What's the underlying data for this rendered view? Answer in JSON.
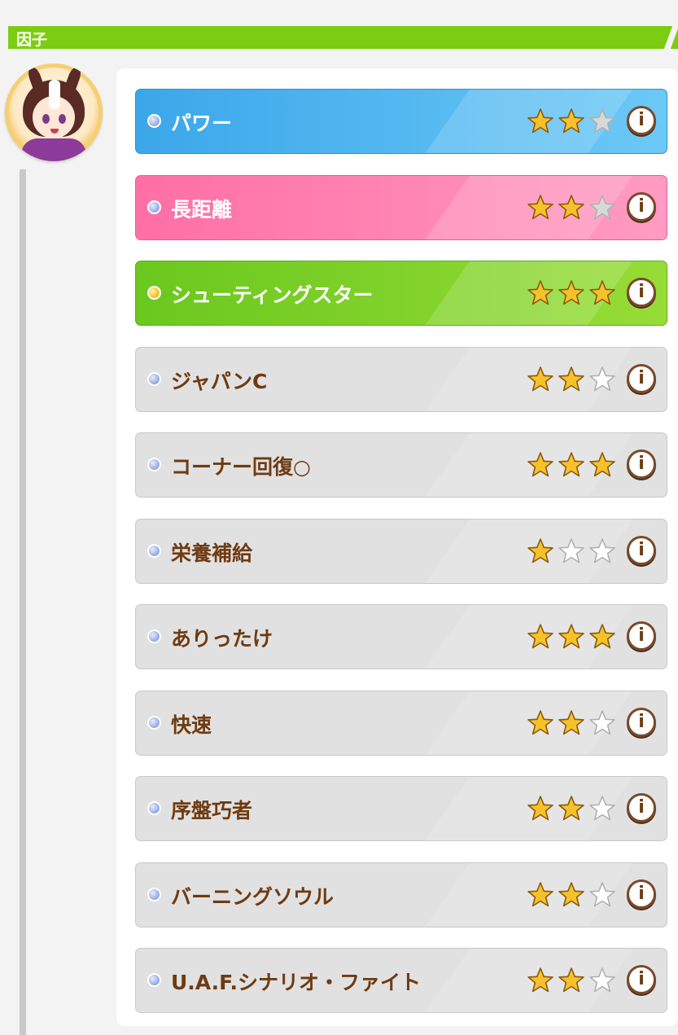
{
  "header": {
    "title": "因子"
  },
  "factors": [
    {
      "name": "パワー",
      "stars": 2,
      "style": "blue",
      "dot": "blue"
    },
    {
      "name": "長距離",
      "stars": 2,
      "style": "pink",
      "dot": "blue"
    },
    {
      "name": "シューティングスター",
      "stars": 3,
      "style": "green",
      "dot": "gold"
    },
    {
      "name": "ジャパンC",
      "stars": 2,
      "style": "grey",
      "dot": "blue"
    },
    {
      "name": "コーナー回復○",
      "stars": 3,
      "style": "grey",
      "dot": "blue"
    },
    {
      "name": "栄養補給",
      "stars": 1,
      "style": "grey",
      "dot": "blue"
    },
    {
      "name": "ありったけ",
      "stars": 3,
      "style": "grey",
      "dot": "blue"
    },
    {
      "name": "快速",
      "stars": 2,
      "style": "grey",
      "dot": "blue"
    },
    {
      "name": "序盤巧者",
      "stars": 2,
      "style": "grey",
      "dot": "blue"
    },
    {
      "name": "バーニングソウル",
      "stars": 2,
      "style": "grey",
      "dot": "blue"
    },
    {
      "name": "U.A.F.シナリオ・ファイト",
      "stars": 2,
      "style": "grey",
      "dot": "blue"
    }
  ],
  "info_button_label": "i",
  "colors": {
    "header_green": "#7ccc12",
    "star_filled": "#f7c12a",
    "star_empty_grey_row": "#ffffff",
    "star_empty_colored_row": "#d8d8d8",
    "label_brown": "#6e3b12"
  }
}
